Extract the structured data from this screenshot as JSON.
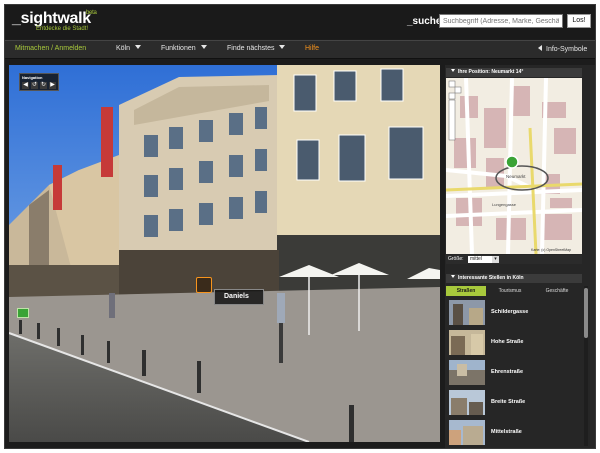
{
  "header": {
    "logo_underscore": "_",
    "logo_text": "sightwalk",
    "beta": "beta",
    "tagline": "Entdecke die Stadt!",
    "search_label": "_suche",
    "search_placeholder": "Suchbegriff (Adresse, Marke, Geschäft)",
    "search_button": "Los!"
  },
  "nav": {
    "login": "Mitmachen / Anmelden",
    "city": "Köln",
    "functions": "Funktionen",
    "nearest": "Finde nächstes",
    "help": "Hilfe",
    "info_symbols": "Info-Symbole"
  },
  "streetview": {
    "navigation_label": "Navigation",
    "nav_buttons": [
      "◀",
      "↺",
      "↻",
      "▶"
    ],
    "place_label": "Daniels"
  },
  "map": {
    "title": "Ihre Position: Neumarkt 14°",
    "street_labels": {
      "neumarkt": "Neumarkt",
      "lungengasse": "Lungengasse",
      "attribution": "Karte: (c) OpenStreetMap"
    },
    "zoom_label": "Größe:",
    "zoom_value": "mittel",
    "zoom_button": "▾"
  },
  "poi": {
    "title": "Interessante Stellen in Köln",
    "tabs": [
      "Straßen",
      "Tourismus",
      "Geschäfte"
    ],
    "items": [
      "Schildergasse",
      "Hohe Straße",
      "Ehrenstraße",
      "Breite Straße",
      "Mittelstraße"
    ]
  },
  "colors": {
    "accent_green": "#a8c93c",
    "accent_orange": "#f7941d",
    "background": "#1c1c1c"
  }
}
